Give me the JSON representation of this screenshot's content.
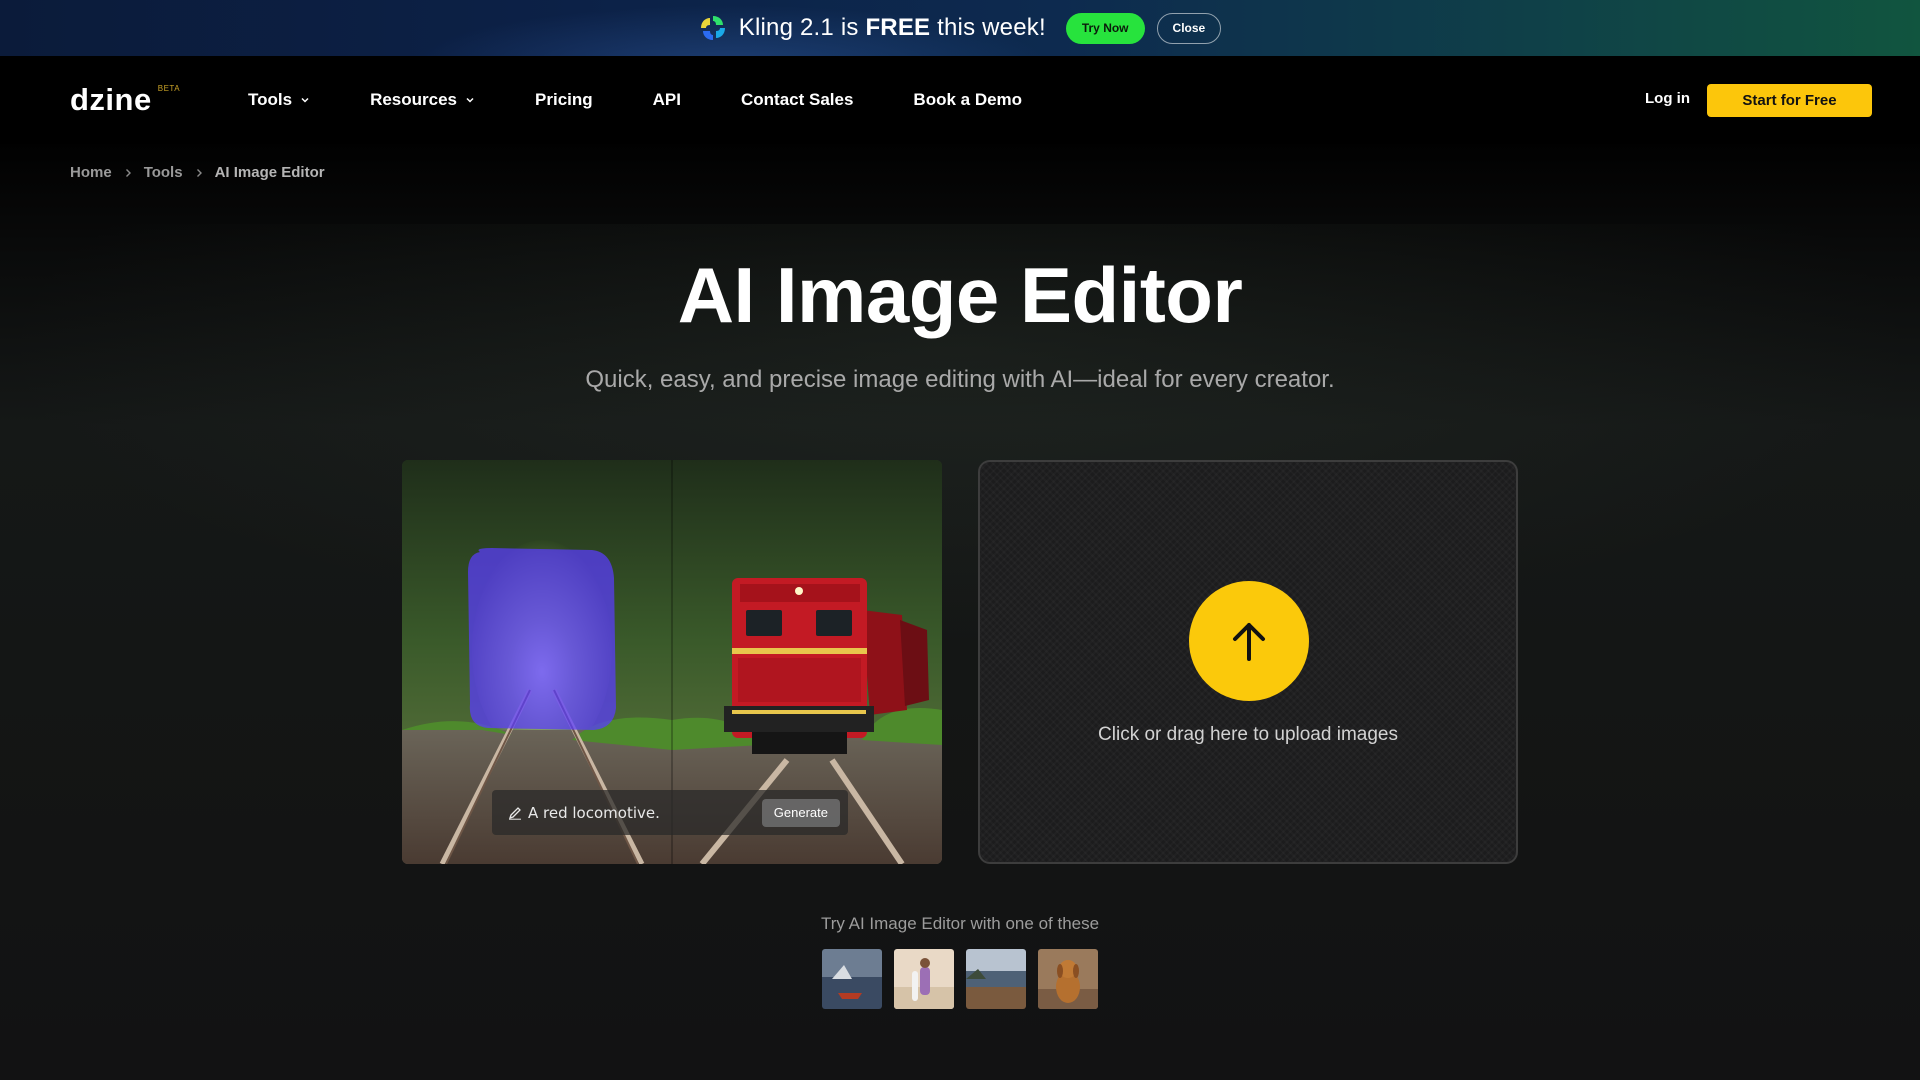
{
  "promo": {
    "logo_icon": "kling-logo-icon",
    "text_before": "Kling 2.1 is ",
    "text_bold": "FREE",
    "text_after": " this week!",
    "try_now": "Try Now",
    "close": "Close"
  },
  "nav": {
    "logo": "dzine",
    "beta": "BETA",
    "items": [
      {
        "label": "Tools",
        "dropdown": true
      },
      {
        "label": "Resources",
        "dropdown": true
      },
      {
        "label": "Pricing",
        "dropdown": false
      },
      {
        "label": "API",
        "dropdown": false
      },
      {
        "label": "Contact Sales",
        "dropdown": false
      },
      {
        "label": "Book a Demo",
        "dropdown": false
      }
    ],
    "login": "Log in",
    "start_free": "Start for Free"
  },
  "breadcrumb": [
    "Home",
    "Tools",
    "AI Image Editor"
  ],
  "hero": {
    "title": "AI Image Editor",
    "subtitle": "Quick, easy, and precise image editing with AI—ideal for every creator."
  },
  "demo": {
    "prompt": "A red locomotive.",
    "generate": "Generate"
  },
  "upload": {
    "icon": "arrow-up-icon",
    "text": "Click or drag here to upload images"
  },
  "samples": {
    "label": "Try AI Image Editor with one of these",
    "items": [
      "sample-boat-on-sea",
      "sample-surfer-on-beach",
      "sample-coast-landscape",
      "sample-dog-portrait"
    ]
  },
  "colors": {
    "accent": "#fcc60b",
    "try_now": "#27e33d",
    "mask": "#5a3cff"
  }
}
